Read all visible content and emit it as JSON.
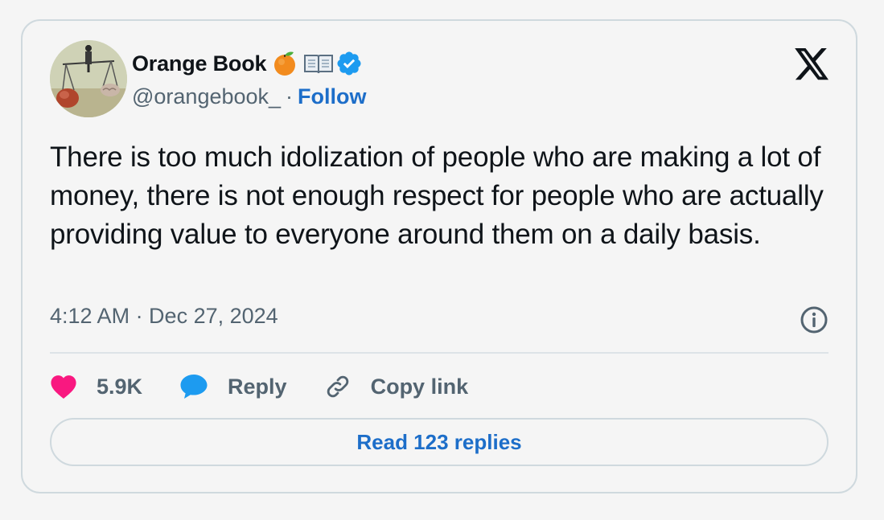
{
  "author": {
    "name": "Orange Book",
    "name_emojis": [
      "orange-emoji",
      "open-book-emoji"
    ],
    "verified_icon": "verified-badge-icon",
    "handle": "@orangebook_",
    "separator": "·",
    "follow_label": "Follow"
  },
  "platform_icon": "x-logo-icon",
  "tweet": {
    "text": "There is too much idolization of people who are making a lot of money, there is not enough respect for people who are actually providing value to everyone around them on a daily basis.",
    "timestamp": "4:12 AM · Dec 27, 2024"
  },
  "actions": {
    "like_count": "5.9K",
    "reply_label": "Reply",
    "copy_link_label": "Copy link"
  },
  "read_replies_label": "Read 123 replies",
  "colors": {
    "background": "#f5f5f5",
    "border": "#cfd9de",
    "link_blue": "#1d6ec9",
    "like_pink": "#f91880",
    "reply_blue": "#1d9bf0",
    "secondary_text": "#536471",
    "primary_text": "#0f1419"
  }
}
